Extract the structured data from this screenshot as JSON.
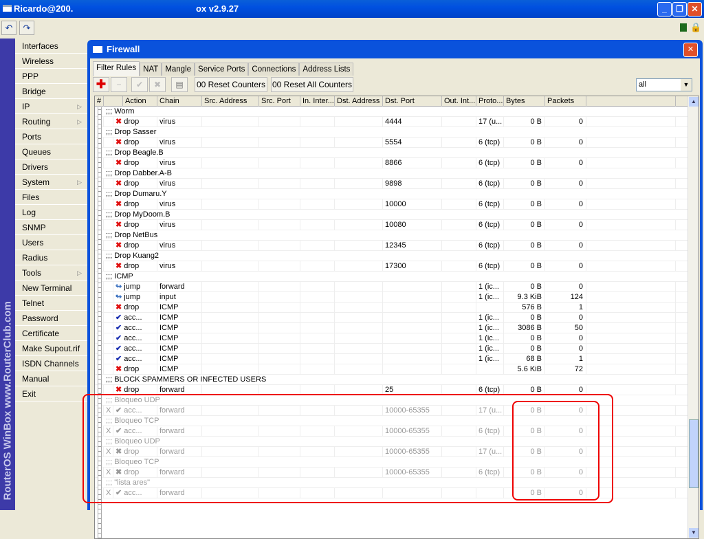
{
  "app": {
    "title_left": "Ricardo@200.",
    "title_right": "ox v2.9.27",
    "brand_vertical": "RouterOS WinBox   www.RouterClub.com"
  },
  "sidebar": {
    "items": [
      {
        "label": "Interfaces"
      },
      {
        "label": "Wireless"
      },
      {
        "label": "PPP"
      },
      {
        "label": "Bridge"
      },
      {
        "label": "IP",
        "submenu": true
      },
      {
        "label": "Routing",
        "submenu": true
      },
      {
        "label": "Ports"
      },
      {
        "label": "Queues"
      },
      {
        "label": "Drivers"
      },
      {
        "label": "System",
        "submenu": true
      },
      {
        "label": "Files"
      },
      {
        "label": "Log"
      },
      {
        "label": "SNMP"
      },
      {
        "label": "Users"
      },
      {
        "label": "Radius"
      },
      {
        "label": "Tools",
        "submenu": true
      },
      {
        "label": "New Terminal"
      },
      {
        "label": "Telnet"
      },
      {
        "label": "Password"
      },
      {
        "label": "Certificate"
      },
      {
        "label": "Make Supout.rif"
      },
      {
        "label": "ISDN Channels"
      },
      {
        "label": "Manual"
      },
      {
        "label": "Exit"
      }
    ]
  },
  "firewall": {
    "title": "Firewall",
    "tabs": [
      "Filter Rules",
      "NAT",
      "Mangle",
      "Service Ports",
      "Connections",
      "Address Lists"
    ],
    "reset_counters": "00 Reset Counters",
    "reset_all_counters": "00 Reset All Counters",
    "filter_value": "all",
    "columns": [
      "#",
      "",
      "Action",
      "Chain",
      "Src. Address",
      "Src. Port",
      "In. Inter...",
      "Dst. Address",
      "Dst. Port",
      "Out. Int...",
      "Proto...",
      "Bytes",
      "Packets"
    ],
    "rows": [
      {
        "comment": ";;; Worm"
      },
      {
        "icon": "drop",
        "action": "drop",
        "chain": "virus",
        "dst_port": "4444",
        "proto": "17 (u...",
        "bytes": "0 B",
        "packets": "0"
      },
      {
        "comment": ";;; Drop Sasser"
      },
      {
        "icon": "drop",
        "action": "drop",
        "chain": "virus",
        "dst_port": "5554",
        "proto": "6 (tcp)",
        "bytes": "0 B",
        "packets": "0"
      },
      {
        "comment": ";;; Drop Beagle.B"
      },
      {
        "icon": "drop",
        "action": "drop",
        "chain": "virus",
        "dst_port": "8866",
        "proto": "6 (tcp)",
        "bytes": "0 B",
        "packets": "0"
      },
      {
        "comment": ";;; Drop Dabber.A-B"
      },
      {
        "icon": "drop",
        "action": "drop",
        "chain": "virus",
        "dst_port": "9898",
        "proto": "6 (tcp)",
        "bytes": "0 B",
        "packets": "0"
      },
      {
        "comment": ";;; Drop Dumaru.Y"
      },
      {
        "icon": "drop",
        "action": "drop",
        "chain": "virus",
        "dst_port": "10000",
        "proto": "6 (tcp)",
        "bytes": "0 B",
        "packets": "0"
      },
      {
        "comment": ";;; Drop MyDoom.B"
      },
      {
        "icon": "drop",
        "action": "drop",
        "chain": "virus",
        "dst_port": "10080",
        "proto": "6 (tcp)",
        "bytes": "0 B",
        "packets": "0"
      },
      {
        "comment": ";;; Drop NetBus"
      },
      {
        "icon": "drop",
        "action": "drop",
        "chain": "virus",
        "dst_port": "12345",
        "proto": "6 (tcp)",
        "bytes": "0 B",
        "packets": "0"
      },
      {
        "comment": ";;; Drop Kuang2"
      },
      {
        "icon": "drop",
        "action": "drop",
        "chain": "virus",
        "dst_port": "17300",
        "proto": "6 (tcp)",
        "bytes": "0 B",
        "packets": "0"
      },
      {
        "comment": ";;; ICMP"
      },
      {
        "icon": "jump",
        "action": "jump",
        "chain": "forward",
        "dst_port": "",
        "proto": "1 (ic...",
        "bytes": "0 B",
        "packets": "0"
      },
      {
        "icon": "jump",
        "action": "jump",
        "chain": "input",
        "dst_port": "",
        "proto": "1 (ic...",
        "bytes": "9.3 KiB",
        "packets": "124"
      },
      {
        "icon": "drop",
        "action": "drop",
        "chain": "ICMP",
        "dst_port": "",
        "proto": "",
        "bytes": "576 B",
        "packets": "1"
      },
      {
        "icon": "accept",
        "action": "acc...",
        "chain": "ICMP",
        "dst_port": "",
        "proto": "1 (ic...",
        "bytes": "0 B",
        "packets": "0"
      },
      {
        "icon": "accept",
        "action": "acc...",
        "chain": "ICMP",
        "dst_port": "",
        "proto": "1 (ic...",
        "bytes": "3086 B",
        "packets": "50"
      },
      {
        "icon": "accept",
        "action": "acc...",
        "chain": "ICMP",
        "dst_port": "",
        "proto": "1 (ic...",
        "bytes": "0 B",
        "packets": "0"
      },
      {
        "icon": "accept",
        "action": "acc...",
        "chain": "ICMP",
        "dst_port": "",
        "proto": "1 (ic...",
        "bytes": "0 B",
        "packets": "0"
      },
      {
        "icon": "accept",
        "action": "acc...",
        "chain": "ICMP",
        "dst_port": "",
        "proto": "1 (ic...",
        "bytes": "68 B",
        "packets": "1"
      },
      {
        "icon": "drop",
        "action": "drop",
        "chain": "ICMP",
        "dst_port": "",
        "proto": "",
        "bytes": "5.6 KiB",
        "packets": "72"
      },
      {
        "comment": ";;; BLOCK SPAMMERS OR INFECTED USERS"
      },
      {
        "icon": "drop",
        "action": "drop",
        "chain": "forward",
        "dst_port": "25",
        "proto": "6 (tcp)",
        "bytes": "0 B",
        "packets": "0"
      },
      {
        "comment": ";;; Bloqueo UDP",
        "disabled": true
      },
      {
        "disabled": true,
        "flag": "X",
        "icon": "accept",
        "action": "acc...",
        "chain": "forward",
        "dst_port": "10000-65355",
        "proto": "17 (u...",
        "bytes": "0 B",
        "packets": "0"
      },
      {
        "comment": ";;; Bloqueo TCP",
        "disabled": true
      },
      {
        "disabled": true,
        "flag": "X",
        "icon": "accept",
        "action": "acc...",
        "chain": "forward",
        "dst_port": "10000-65355",
        "proto": "6 (tcp)",
        "bytes": "0 B",
        "packets": "0"
      },
      {
        "comment": ";;; Bloqueo UDP",
        "disabled": true
      },
      {
        "disabled": true,
        "flag": "X",
        "icon": "drop",
        "action": "drop",
        "chain": "forward",
        "dst_port": "10000-65355",
        "proto": "17 (u...",
        "bytes": "0 B",
        "packets": "0"
      },
      {
        "comment": ";;; Bloqueo TCP",
        "disabled": true
      },
      {
        "disabled": true,
        "flag": "X",
        "icon": "drop",
        "action": "drop",
        "chain": "forward",
        "dst_port": "10000-65355",
        "proto": "6 (tcp)",
        "bytes": "0 B",
        "packets": "0"
      },
      {
        "comment": ";;; \"lista ares\"",
        "disabled": true
      },
      {
        "disabled": true,
        "flag": "X",
        "icon": "accept",
        "action": "acc...",
        "chain": "forward",
        "dst_port": "",
        "proto": "",
        "bytes": "0 B",
        "packets": "0"
      }
    ]
  },
  "colors": {
    "drop": "#e01010",
    "accept": "#1a2fb0",
    "jump": "#3a70c0",
    "disabled": "#999999"
  }
}
